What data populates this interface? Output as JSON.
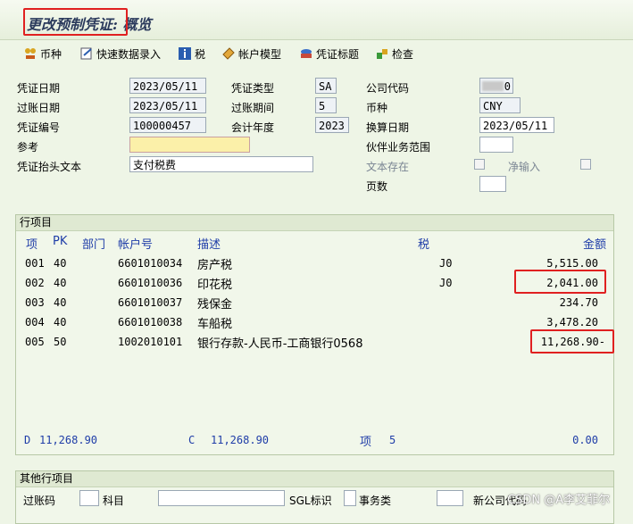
{
  "title": "更改预制凭证: 概览",
  "toolbar": [
    {
      "label": "币种",
      "icon": "currency-icon"
    },
    {
      "label": "快速数据录入",
      "icon": "fast-entry-icon"
    },
    {
      "label": "税",
      "icon": "info-icon"
    },
    {
      "label": "帐户模型",
      "icon": "account-model-icon"
    },
    {
      "label": "凭证标题",
      "icon": "document-header-icon"
    },
    {
      "label": "检查",
      "icon": "check-icon"
    }
  ],
  "header": {
    "doc_date_label": "凭证日期",
    "doc_date": "2023/05/11",
    "doc_type_label": "凭证类型",
    "doc_type": "SA",
    "company_code_label": "公司代码",
    "company_code": "0",
    "posting_date_label": "过账日期",
    "posting_date": "2023/05/11",
    "period_label": "过账期间",
    "period": "5",
    "currency_label": "币种",
    "currency": "CNY",
    "doc_number_label": "凭证编号",
    "doc_number": "100000457",
    "fiscal_year_label": "会计年度",
    "fiscal_year": "2023",
    "translation_date_label": "换算日期",
    "translation_date": "2023/05/11",
    "reference_label": "参考",
    "reference": "",
    "partner_area_label": "伙伴业务范围",
    "partner_area": "",
    "header_text_label": "凭证抬头文本",
    "header_text": "支付税费",
    "text_exists_label": "文本存在",
    "net_entry_label": "净输入",
    "pages_label": "页数",
    "pages": ""
  },
  "line_items": {
    "section_title": "行项目",
    "columns": {
      "item": "项",
      "pk": "PK",
      "dept": "部门",
      "account": "帐户号",
      "desc": "描述",
      "tax": "税",
      "amount": "金额"
    },
    "rows": [
      {
        "item": "001",
        "pk": "40",
        "account": "6601010034",
        "desc": "房产税",
        "tax": "J0",
        "amount": "5,515.00"
      },
      {
        "item": "002",
        "pk": "40",
        "account": "6601010036",
        "desc": "印花税",
        "tax": "J0",
        "amount": "2,041.00"
      },
      {
        "item": "003",
        "pk": "40",
        "account": "6601010037",
        "desc": "残保金",
        "tax": "",
        "amount": "234.70"
      },
      {
        "item": "004",
        "pk": "40",
        "account": "6601010038",
        "desc": "车船税",
        "tax": "",
        "amount": "3,478.20"
      },
      {
        "item": "005",
        "pk": "50",
        "account": "1002010101",
        "desc": "银行存款-人民币-工商银行0568",
        "tax": "",
        "amount": "11,268.90-"
      }
    ],
    "totals": {
      "debit_label": "D",
      "debit": "11,268.90",
      "credit_label": "C",
      "credit": "11,268.90",
      "items_label": "项",
      "items": "5",
      "balance": "0.00"
    }
  },
  "other_items": {
    "section_title": "其他行项目",
    "posting_key_label": "过账码",
    "account_label": "科目",
    "sgl_label": "SGL标识",
    "trans_type_label": "事务类",
    "new_company_label": "新公司代码",
    "watermark": "CSDN @A李艾菲尔"
  },
  "colors": {
    "label_blue": "#1f3da8",
    "highlight_red": "#e02020",
    "required_yellow": "#fbf0a9",
    "background": "#eef5e6"
  }
}
